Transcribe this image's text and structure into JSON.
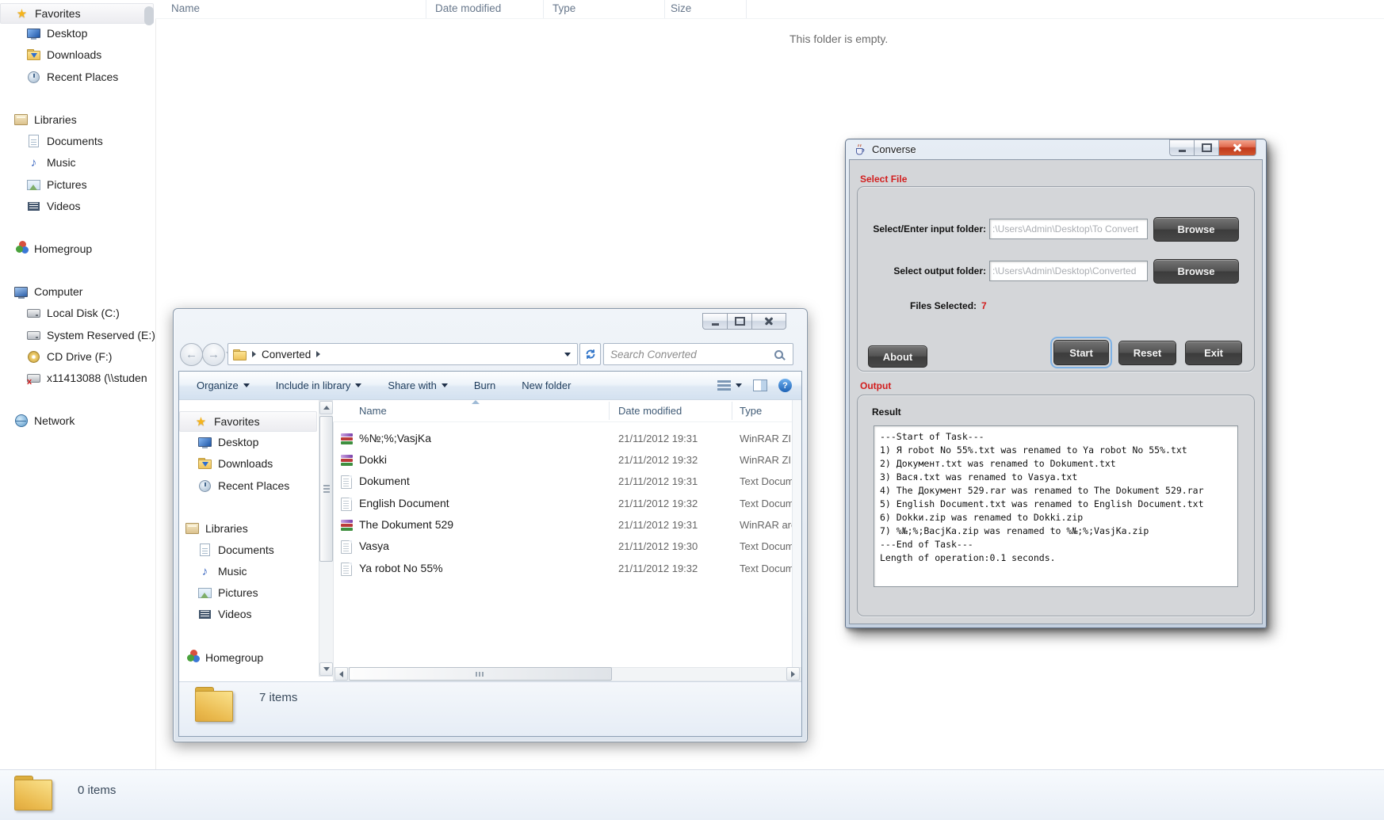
{
  "colors": {
    "accent_red": "#d21e1e",
    "dark_button_gray": "#4a4a4a",
    "focus_ring_blue": "#7fb2e5",
    "folder_yellow": "#eec35b",
    "toolbar_blue": "#d3e1f0"
  },
  "background_window": {
    "columns": {
      "name": "Name",
      "date_modified": "Date modified",
      "type": "Type",
      "size": "Size"
    },
    "empty_message": "This folder is empty.",
    "sidebar": {
      "favorites": "Favorites",
      "desktop": "Desktop",
      "downloads": "Downloads",
      "recent_places": "Recent Places",
      "libraries": "Libraries",
      "documents": "Documents",
      "music": "Music",
      "pictures": "Pictures",
      "videos": "Videos",
      "homegroup": "Homegroup",
      "computer": "Computer",
      "local_disk": "Local Disk (C:)",
      "system_reserved": "System Reserved (E:)",
      "cd_drive": "CD Drive (F:)",
      "network_drive": "x11413088 (\\\\studen",
      "network": "Network"
    },
    "status_bar": {
      "items_count": "0 items"
    }
  },
  "explorer_window": {
    "breadcrumb": {
      "folder": "Converted"
    },
    "search": {
      "placeholder": "Search Converted"
    },
    "toolbar": {
      "organize": "Organize",
      "include_in_library": "Include in library",
      "share_with": "Share with",
      "burn": "Burn",
      "new_folder": "New folder"
    },
    "sidebar": {
      "favorites": "Favorites",
      "desktop": "Desktop",
      "downloads": "Downloads",
      "recent_places": "Recent Places",
      "libraries": "Libraries",
      "documents": "Documents",
      "music": "Music",
      "pictures": "Pictures",
      "videos": "Videos",
      "homegroup": "Homegroup"
    },
    "columns": {
      "name": "Name",
      "date_modified": "Date modified",
      "type": "Type"
    },
    "files": [
      {
        "name": "%№;%;VasjKa",
        "date_modified": "21/11/2012 19:31",
        "type": "WinRAR ZIP",
        "icon": "winrar-archive-icon"
      },
      {
        "name": "Dokki",
        "date_modified": "21/11/2012 19:32",
        "type": "WinRAR ZIP",
        "icon": "winrar-archive-icon"
      },
      {
        "name": "Dokument",
        "date_modified": "21/11/2012 19:31",
        "type": "Text Docume",
        "icon": "text-document-icon"
      },
      {
        "name": "English Document",
        "date_modified": "21/11/2012 19:32",
        "type": "Text Docume",
        "icon": "text-document-icon"
      },
      {
        "name": "The Dokument 529",
        "date_modified": "21/11/2012 19:31",
        "type": "WinRAR arch",
        "icon": "winrar-archive-icon"
      },
      {
        "name": "Vasya",
        "date_modified": "21/11/2012 19:30",
        "type": "Text Docume",
        "icon": "text-document-icon"
      },
      {
        "name": "Ya robot No 55%",
        "date_modified": "21/11/2012 19:32",
        "type": "Text Docume",
        "icon": "text-document-icon"
      }
    ],
    "status_bar": {
      "items_count": "7 items"
    }
  },
  "converse_window": {
    "title": "Converse",
    "select_file_section": {
      "heading": "Select File",
      "input_folder_label": "Select/Enter input folder:",
      "input_folder_value": ":\\Users\\Admin\\Desktop\\To Convert",
      "output_folder_label": "Select output folder:",
      "output_folder_value": ":\\Users\\Admin\\Desktop\\Converted",
      "browse_input": "Browse",
      "browse_output": "Browse",
      "files_selected_label": "Files Selected:",
      "files_selected_value": "7",
      "about_button": "About",
      "start_button": "Start",
      "reset_button": "Reset",
      "exit_button": "Exit"
    },
    "output_section": {
      "heading": "Output",
      "result_label": "Result",
      "result_text": "---Start of Task---\n1) Я robot No 55%.txt was renamed to Ya robot No 55%.txt\n2) Документ.txt was renamed to Dokument.txt\n3) Вася.txt was renamed to Vasya.txt\n4) The Документ 529.rar was renamed to The Dokument 529.rar\n5) English Document.txt was renamed to English Document.txt\n6) Dokkи.zip was renamed to Dokki.zip\n7) %№;%;BacjKa.zip was renamed to %№;%;VasjKa.zip\n---End of Task---\nLength of operation:0.1 seconds."
    }
  }
}
